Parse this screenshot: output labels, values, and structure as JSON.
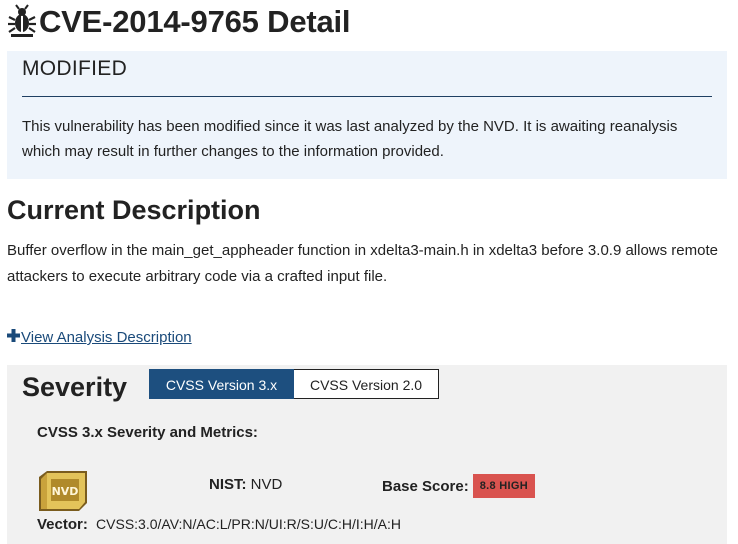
{
  "header": {
    "title": "CVE-2014-9765 Detail",
    "icon": "bug-icon"
  },
  "status_banner": {
    "heading": "MODIFIED",
    "text": "This vulnerability has been modified since it was last analyzed by the NVD. It is awaiting reanalysis which may result in further changes to the information provided.",
    "background": "#eef4fb",
    "rule_color": "#1f3f62"
  },
  "description": {
    "heading": "Current Description",
    "text": "Buffer overflow in the main_get_appheader function in xdelta3-main.h in xdelta3 before 3.0.9 allows remote attackers to execute arbitrary code via a crafted input file."
  },
  "analysis_link": {
    "label": "View Analysis Description",
    "icon": "plus-icon"
  },
  "severity": {
    "heading": "Severity",
    "tabs": [
      {
        "label": "CVSS Version 3.x",
        "active": true
      },
      {
        "label": "CVSS Version 2.0",
        "active": false
      }
    ],
    "metrics_heading": "CVSS 3.x Severity and Metrics:",
    "logo_icon": "nvd-logo",
    "nist_label": "NIST:",
    "nist_value": "NVD",
    "base_score_label": "Base Score:",
    "base_score_badge": "8.8 HIGH",
    "badge_color": "#d9534f",
    "vector_label": "Vector:",
    "vector_value": "CVSS:3.0/AV:N/AC:L/PR:N/UI:R/S:U/C:H/I:H/A:H"
  }
}
